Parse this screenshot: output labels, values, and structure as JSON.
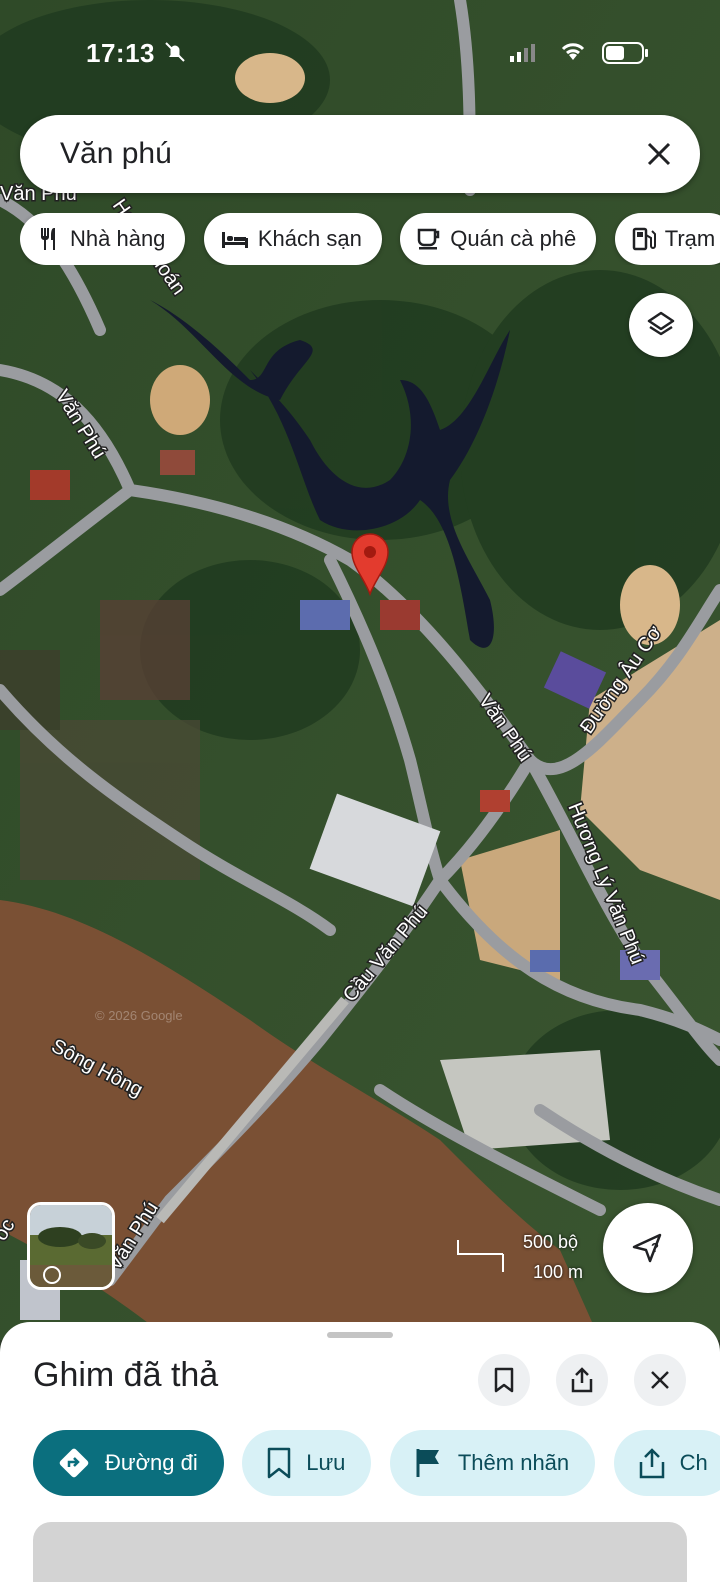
{
  "status_bar": {
    "time": "17:13"
  },
  "search": {
    "query": "Văn phú"
  },
  "chips": [
    {
      "label": "Nhà hàng",
      "icon": "fork-knife-icon"
    },
    {
      "label": "Khách sạn",
      "icon": "bed-icon"
    },
    {
      "label": "Quán cà phê",
      "icon": "coffee-icon"
    },
    {
      "label": "Trạm",
      "icon": "gas-station-icon"
    }
  ],
  "map": {
    "labels": {
      "van_phu_top": "Văn Phú",
      "hang_khoan": "Hang Khoán",
      "van_phu_left": "Văn Phú",
      "van_phu_mid": "Văn Phú",
      "duong_au_co": "Đường Âu Cơ",
      "huong_ly": "Hương Lý Văn Phú",
      "cau_van_phu": "Cầu Văn Phú",
      "song_hong": "Sông Hồng",
      "van_phu_bottom": "Văn Phú",
      "edge_label": "ốc",
      "watermark": "© 2026 Google"
    },
    "scale": {
      "imperial": "500 bộ",
      "metric": "100 m"
    },
    "colors": {
      "pin": "#e33b2e",
      "river": "#7a5034",
      "lake": "#141a2e"
    }
  },
  "sheet": {
    "title": "Ghim đã thả",
    "actions": [
      {
        "label": "Đường đi",
        "icon": "directions-icon"
      },
      {
        "label": "Lưu",
        "icon": "bookmark-icon"
      },
      {
        "label": "Thêm nhãn",
        "icon": "flag-icon"
      },
      {
        "label": "Ch",
        "icon": "share-icon"
      }
    ]
  }
}
